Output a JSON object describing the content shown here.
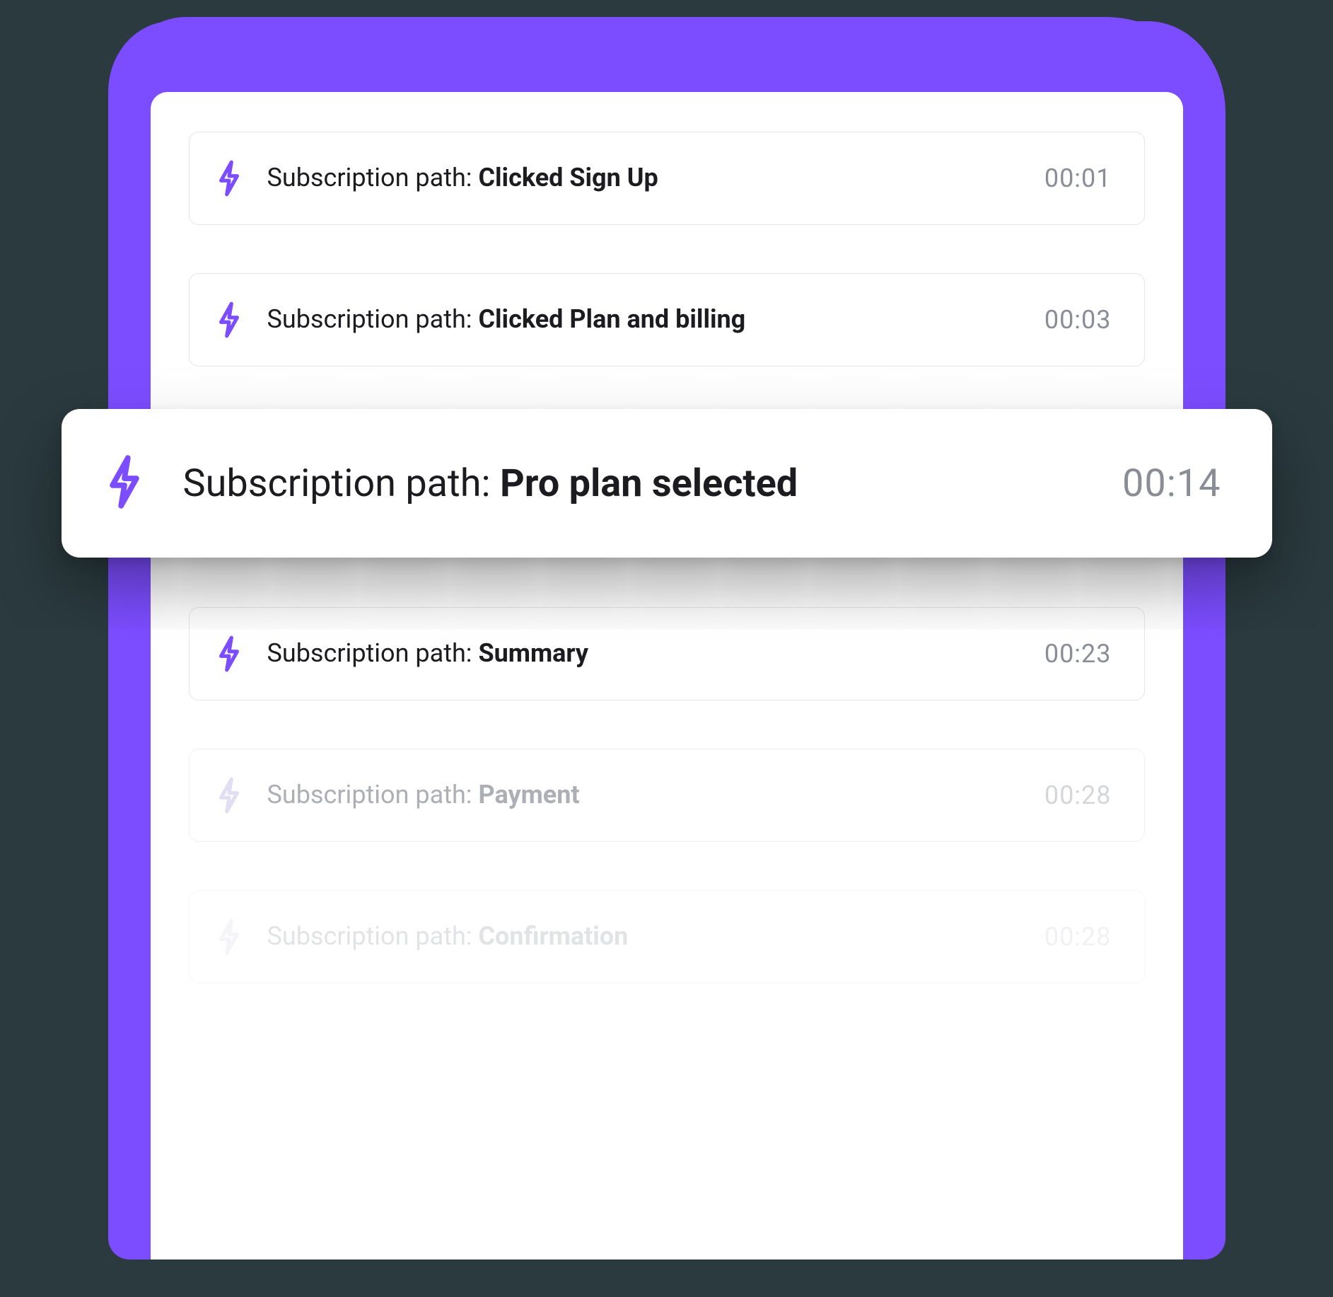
{
  "event_prefix": "Subscription path: ",
  "events": [
    {
      "action": "Clicked Sign Up",
      "time": "00:01",
      "highlighted": false,
      "fade": 0
    },
    {
      "action": "Clicked Plan and billing",
      "time": "00:03",
      "highlighted": false,
      "fade": 0
    },
    {
      "action": "Pro plan selected",
      "time": "00:14",
      "highlighted": true,
      "fade": 0
    },
    {
      "action": "Summary",
      "time": "00:23",
      "highlighted": false,
      "fade": 0
    },
    {
      "action": "Payment",
      "time": "00:28",
      "highlighted": false,
      "fade": 1
    },
    {
      "action": "Confirmation",
      "time": "00:28",
      "highlighted": false,
      "fade": 2
    }
  ],
  "colors": {
    "accent": "#7c4dff",
    "card_bg": "#ffffff",
    "page_bg": "#2a3a3e",
    "text": "#1c1b1f",
    "muted": "#8a8d96",
    "border": "#e5e6ea"
  }
}
